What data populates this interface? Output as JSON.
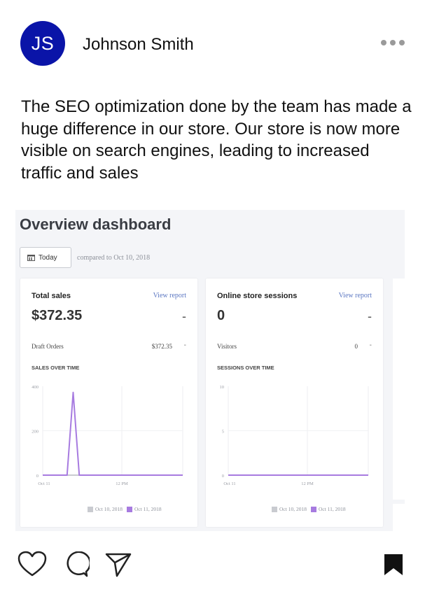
{
  "post": {
    "avatar_initials": "JS",
    "avatar_color": "#0a14a8",
    "username": "Johnson Smith",
    "caption": "The SEO optimization done by the team has made a huge difference in our store. Our store is now more visible on search engines, leading to increased traffic and sales"
  },
  "dashboard": {
    "title": "Overview dashboard",
    "date_button": "Today",
    "compared_text": "compared to Oct 10, 2018",
    "cards": [
      {
        "title": "Total sales",
        "link": "View report",
        "value": "$372.35",
        "value_dash": "-",
        "row_label": "Draft Orders",
        "row_value": "$372.35",
        "row_dash": "-",
        "subtitle": "SALES OVER TIME",
        "legend": [
          "Oct 10, 2018",
          "Oct 11, 2018"
        ]
      },
      {
        "title": "Online store sessions",
        "link": "View report",
        "value": "0",
        "value_dash": "-",
        "row_label": "Visitors",
        "row_value": "0",
        "row_dash": "-",
        "subtitle": "SESSIONS OVER TIME",
        "legend": [
          "Oct 10, 2018",
          "Oct 11, 2018"
        ]
      }
    ]
  },
  "chart_data": [
    {
      "type": "line",
      "title": "SALES OVER TIME",
      "x_ticks": [
        "Oct 11",
        "12 PM"
      ],
      "y_ticks": [
        "0",
        "200",
        "400"
      ],
      "ylim": [
        0,
        400
      ],
      "series": [
        {
          "name": "Oct 10, 2018",
          "color": "#c9cbd0",
          "values": [
            0,
            0,
            0,
            0,
            0,
            0,
            0,
            0,
            0,
            0,
            0,
            0,
            0,
            0,
            0,
            0,
            0,
            0,
            0,
            0,
            0,
            0,
            0,
            0
          ]
        },
        {
          "name": "Oct 11, 2018",
          "color": "#a77be0",
          "values": [
            0,
            0,
            0,
            0,
            0,
            372.35,
            0,
            0,
            0,
            0,
            0,
            0,
            0,
            0,
            0,
            0,
            0,
            0,
            0,
            0,
            0,
            0,
            0,
            0
          ]
        }
      ],
      "legend": "bottom"
    },
    {
      "type": "line",
      "title": "SESSIONS OVER TIME",
      "x_ticks": [
        "Oct 11",
        "12 PM"
      ],
      "y_ticks": [
        "0",
        "5",
        "10"
      ],
      "ylim": [
        0,
        10
      ],
      "series": [
        {
          "name": "Oct 10, 2018",
          "color": "#c9cbd0",
          "values": [
            0,
            0,
            0,
            0,
            0,
            0,
            0,
            0,
            0,
            0,
            0,
            0,
            0,
            0,
            0,
            0,
            0,
            0,
            0,
            0,
            0,
            0,
            0,
            0
          ]
        },
        {
          "name": "Oct 11, 2018",
          "color": "#a77be0",
          "values": [
            0,
            0,
            0,
            0,
            0,
            0,
            0,
            0,
            0,
            0,
            0,
            0,
            0,
            0,
            0,
            0,
            0,
            0,
            0,
            0,
            0,
            0,
            0,
            0
          ]
        }
      ],
      "legend": "bottom"
    }
  ],
  "actions": {
    "like_icon": "heart-icon",
    "comment_icon": "comment-icon",
    "share_icon": "send-icon",
    "save_icon": "bookmark-icon"
  }
}
